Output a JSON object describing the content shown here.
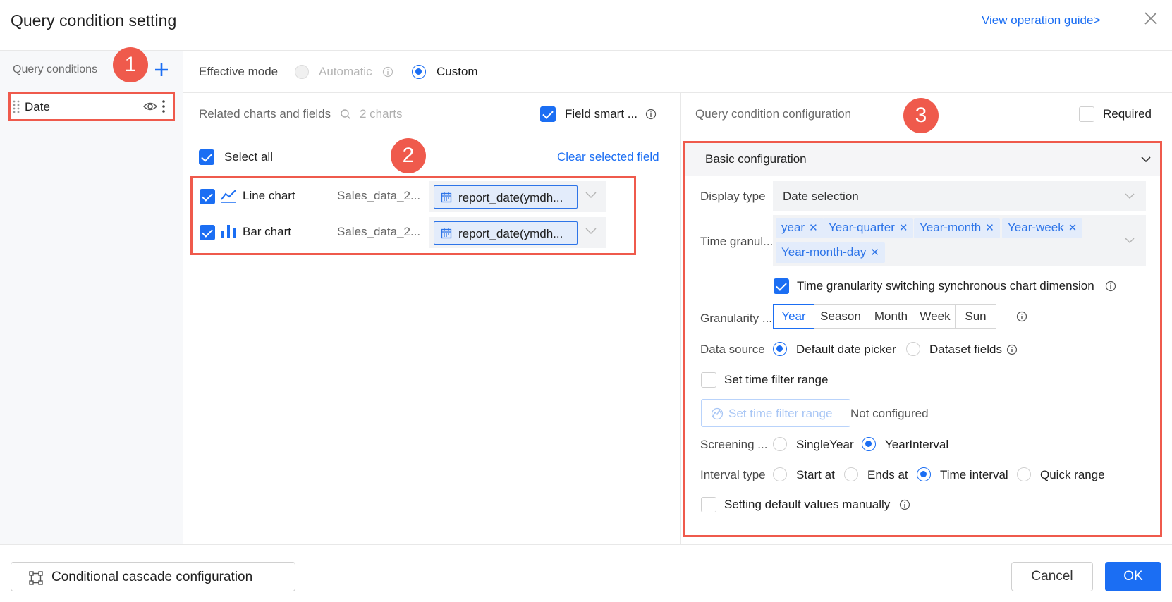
{
  "dialog": {
    "title": "Query condition setting",
    "guide_link": "View operation guide>"
  },
  "sidebar": {
    "label": "Query conditions",
    "items": [
      {
        "label": "Date"
      }
    ]
  },
  "effective_mode": {
    "label": "Effective mode",
    "options": [
      {
        "label": "Automatic",
        "selected": false,
        "disabled": true
      },
      {
        "label": "Custom",
        "selected": true
      }
    ]
  },
  "related": {
    "label": "Related charts and fields",
    "search_placeholder": "2 charts",
    "field_smart_label": "Field smart ...",
    "field_smart_checked": true,
    "select_all_label": "Select all",
    "clear_label": "Clear selected field",
    "charts": [
      {
        "name": "Line chart",
        "dataset": "Sales_data_2...",
        "field": "report_date(ymdh...",
        "icon": "line-chart-icon",
        "checked": true
      },
      {
        "name": "Bar chart",
        "dataset": "Sales_data_2...",
        "field": "report_date(ymdh...",
        "icon": "bar-chart-icon",
        "checked": true
      }
    ]
  },
  "config": {
    "title": "Query condition configuration",
    "required_label": "Required",
    "required_checked": false,
    "basic_label": "Basic configuration",
    "display_type": {
      "label": "Display type",
      "value": "Date selection"
    },
    "time_granularity": {
      "label": "Time granul...",
      "tags": [
        "year",
        "Year-quarter",
        "Year-month",
        "Year-week",
        "Year-month-day"
      ]
    },
    "sync_label": "Time granularity switching synchronous chart dimension",
    "sync_checked": true,
    "granularity": {
      "label": "Granularity ...",
      "options": [
        "Year",
        "Season",
        "Month",
        "Week",
        "Sun"
      ],
      "selected": "Year"
    },
    "data_source": {
      "label": "Data source",
      "options": [
        "Default date picker",
        "Dataset fields"
      ],
      "selected": "Default date picker"
    },
    "time_filter_label": "Set time filter range",
    "time_filter_checked": false,
    "time_filter_button": "Set time filter range",
    "not_configured": "Not configured",
    "screening": {
      "label": "Screening ...",
      "options": [
        "SingleYear",
        "YearInterval"
      ],
      "selected": "YearInterval"
    },
    "interval_type": {
      "label": "Interval type",
      "options": [
        "Start at",
        "Ends at",
        "Time interval",
        "Quick range"
      ],
      "selected": "Time interval"
    },
    "default_values_label": "Setting default values manually",
    "default_values_checked": false
  },
  "footer": {
    "cascade_label": "Conditional cascade configuration",
    "cancel_label": "Cancel",
    "ok_label": "OK"
  },
  "annotations": [
    "1",
    "2",
    "3"
  ],
  "colors": {
    "accent": "#1b6ef3",
    "highlight": "#ef5a4c"
  }
}
